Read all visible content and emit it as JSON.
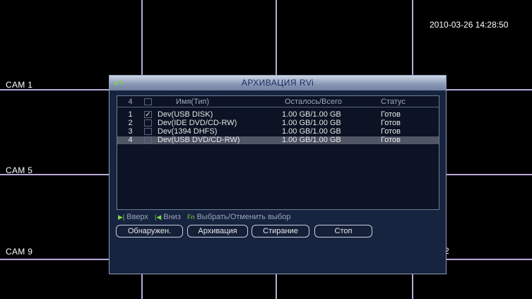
{
  "screen": {
    "timestamp": "2010-03-26 14:28:50",
    "cameras": [
      "CAM 1",
      "CAM 5",
      "CAM 9"
    ],
    "partial_channel_number": "2"
  },
  "dialog": {
    "title": "АРХИВАЦИЯ RVi",
    "icon": "pencil-icon",
    "table": {
      "header": {
        "count": "4",
        "name": "Имя(Тип)",
        "space": "Осталось/Всего",
        "status": "Статус"
      },
      "rows": [
        {
          "index": "1",
          "checked": true,
          "check_mark": "✓",
          "name": "Dev(USB DISK)",
          "space": "1.00 GB/1.00 GB",
          "status": "Готов"
        },
        {
          "index": "2",
          "checked": false,
          "check_mark": "",
          "name": "Dev(IDE DVD/CD-RW)",
          "space": "1.00 GB/1.00 GB",
          "status": "Готов"
        },
        {
          "index": "3",
          "checked": false,
          "check_mark": "",
          "name": "Dev(1394 DHFS)",
          "space": "1.00 GB/1.00 GB",
          "status": "Готов"
        },
        {
          "index": "4",
          "checked": false,
          "check_mark": "",
          "name": "Dev(USB DVD/CD-RW)",
          "space": "1.00 GB/1.00 GB",
          "status": "Готов",
          "selected": true
        }
      ]
    },
    "hints": {
      "up_label": "Вверх",
      "down_label": "Вниз",
      "fn_label": "Выбрать/Отменить выбор",
      "fn_key": "Fn"
    },
    "buttons": {
      "detect": "Обнаружен.",
      "archive": "Архивация",
      "erase": "Стирание",
      "stop": "Стоп"
    }
  },
  "colors": {
    "grid": "#b8a9d9",
    "dialog_bg": "#17243f",
    "title_text": "#1c2c63",
    "hint_icon": "#7fd34a"
  }
}
